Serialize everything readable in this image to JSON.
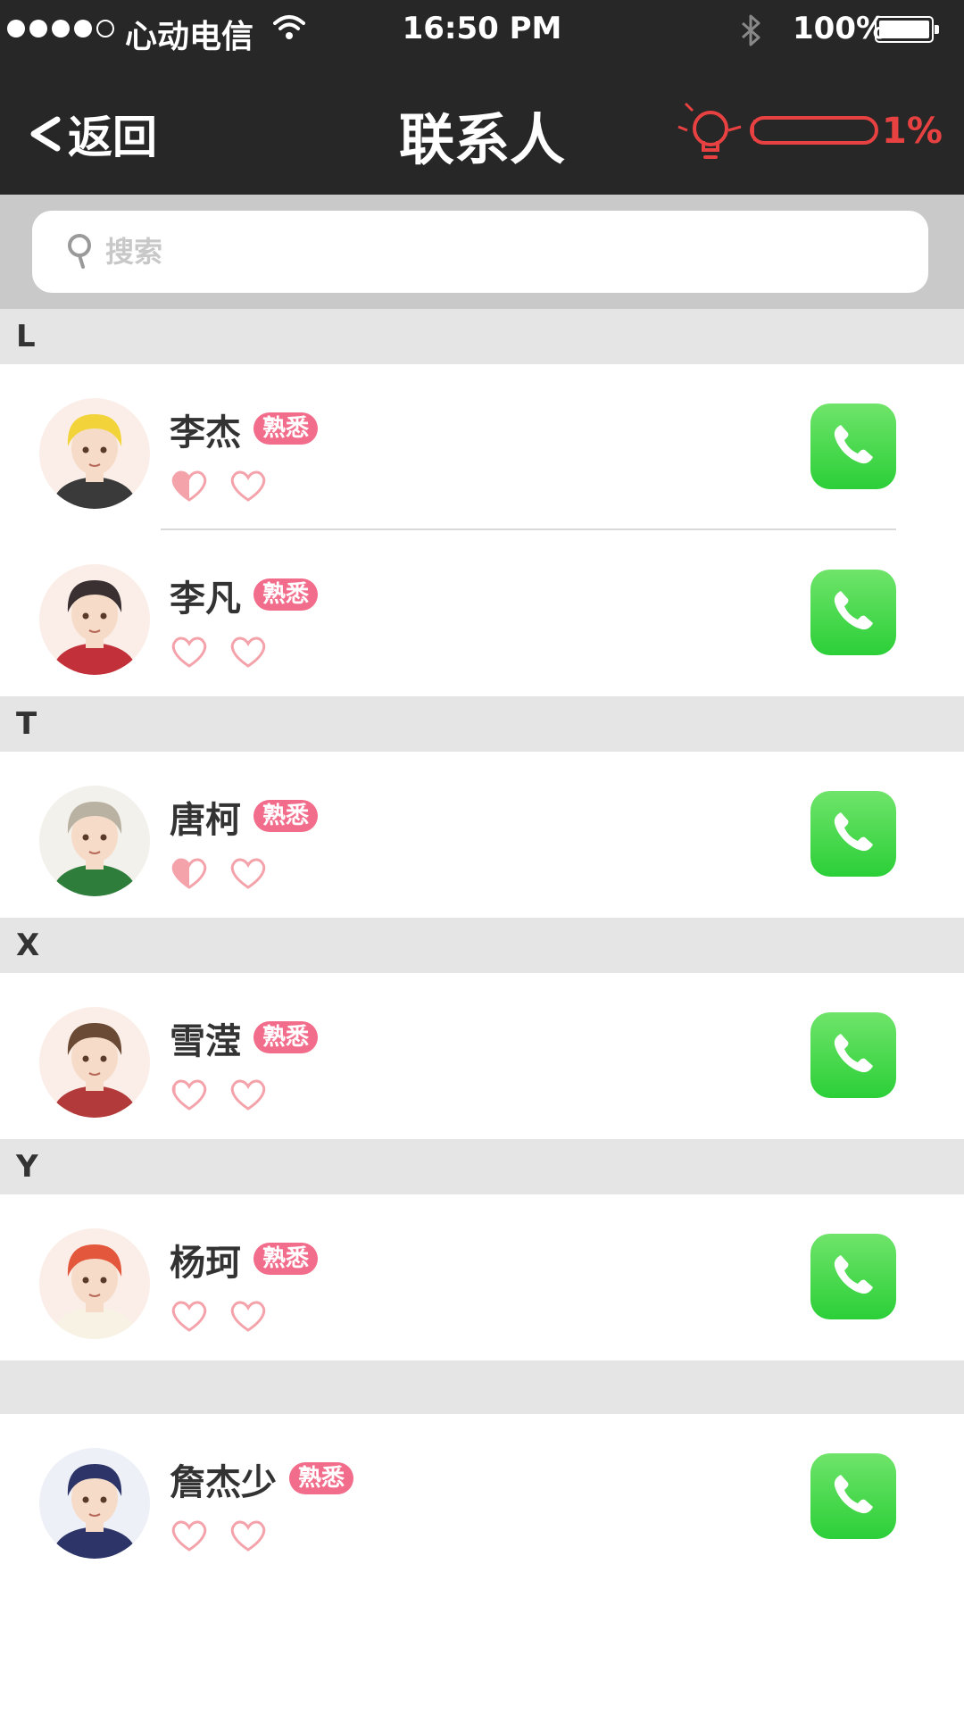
{
  "status_bar": {
    "carrier": "心动电信",
    "time": "16:50 PM",
    "battery": "100%",
    "signal_bars_filled": 4,
    "signal_bars_total": 5
  },
  "nav": {
    "back_label": "返回",
    "title": "联系人",
    "progress_label": "1%",
    "progress_value": 0.01
  },
  "search": {
    "placeholder": "搜索"
  },
  "colors": {
    "bar_bg": "#272727",
    "accent_red": "#e84141",
    "badge_pink": "#f26d8b",
    "call_green": "#2bcf38",
    "heart_pink": "#f4a3ab"
  },
  "sections": [
    {
      "letter": "L",
      "contacts": [
        {
          "name": "李杰",
          "tag": "熟悉",
          "hearts": [
            0.5,
            0
          ],
          "avatar": "blond-boy-avatar"
        },
        {
          "name": "李凡",
          "tag": "熟悉",
          "hearts": [
            0,
            0
          ],
          "avatar": "dark-hair-boy-avatar"
        }
      ]
    },
    {
      "letter": "T",
      "contacts": [
        {
          "name": "唐柯",
          "tag": "熟悉",
          "hearts": [
            0.5,
            0
          ],
          "avatar": "glasses-boy-avatar"
        }
      ]
    },
    {
      "letter": "X",
      "contacts": [
        {
          "name": "雪滢",
          "tag": "熟悉",
          "hearts": [
            0.15,
            0
          ],
          "avatar": "brown-hair-girl-avatar"
        }
      ]
    },
    {
      "letter": "Y",
      "contacts": [
        {
          "name": "杨珂",
          "tag": "熟悉",
          "hearts": [
            0,
            0
          ],
          "avatar": "red-hair-girl-avatar"
        }
      ]
    },
    {
      "letter": "",
      "contacts": [
        {
          "name": "詹杰少",
          "tag": "熟悉",
          "hearts": [
            0,
            0
          ],
          "avatar": "captain-boy-avatar"
        }
      ]
    }
  ]
}
